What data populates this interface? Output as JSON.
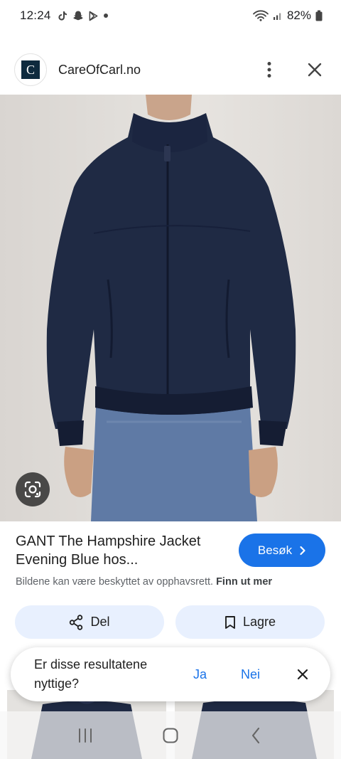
{
  "status_bar": {
    "time": "12:24",
    "battery": "82%",
    "left_icons": [
      "tiktok-icon",
      "snapchat-icon",
      "play-store-icon",
      "dot-icon"
    ],
    "right_icons": [
      "wifi-icon",
      "signal-icon",
      "battery-icon"
    ]
  },
  "header": {
    "site_name": "CareOfCarl.no",
    "logo_text": "C",
    "menu_icon": "more-vert-icon",
    "close_icon": "close-icon"
  },
  "image": {
    "description_icon": "google-lens-icon",
    "jacket_color": "#1f2a44",
    "jeans_color": "#5f7aa5"
  },
  "product": {
    "title": "GANT The Hampshire Jacket Evening Blue hos...",
    "visit_label": "Besøk",
    "copyright_text": "Bildene kan være beskyttet av opphavsrett.",
    "copyright_link": "Finn ut mer"
  },
  "actions": {
    "share_label": "Del",
    "save_label": "Lagre"
  },
  "feedback": {
    "question": "Er disse resultatene nyttige?",
    "yes_label": "Ja",
    "no_label": "Nei"
  },
  "colors": {
    "accent": "#1a73e8",
    "chip_bg": "#e8f0fe"
  }
}
